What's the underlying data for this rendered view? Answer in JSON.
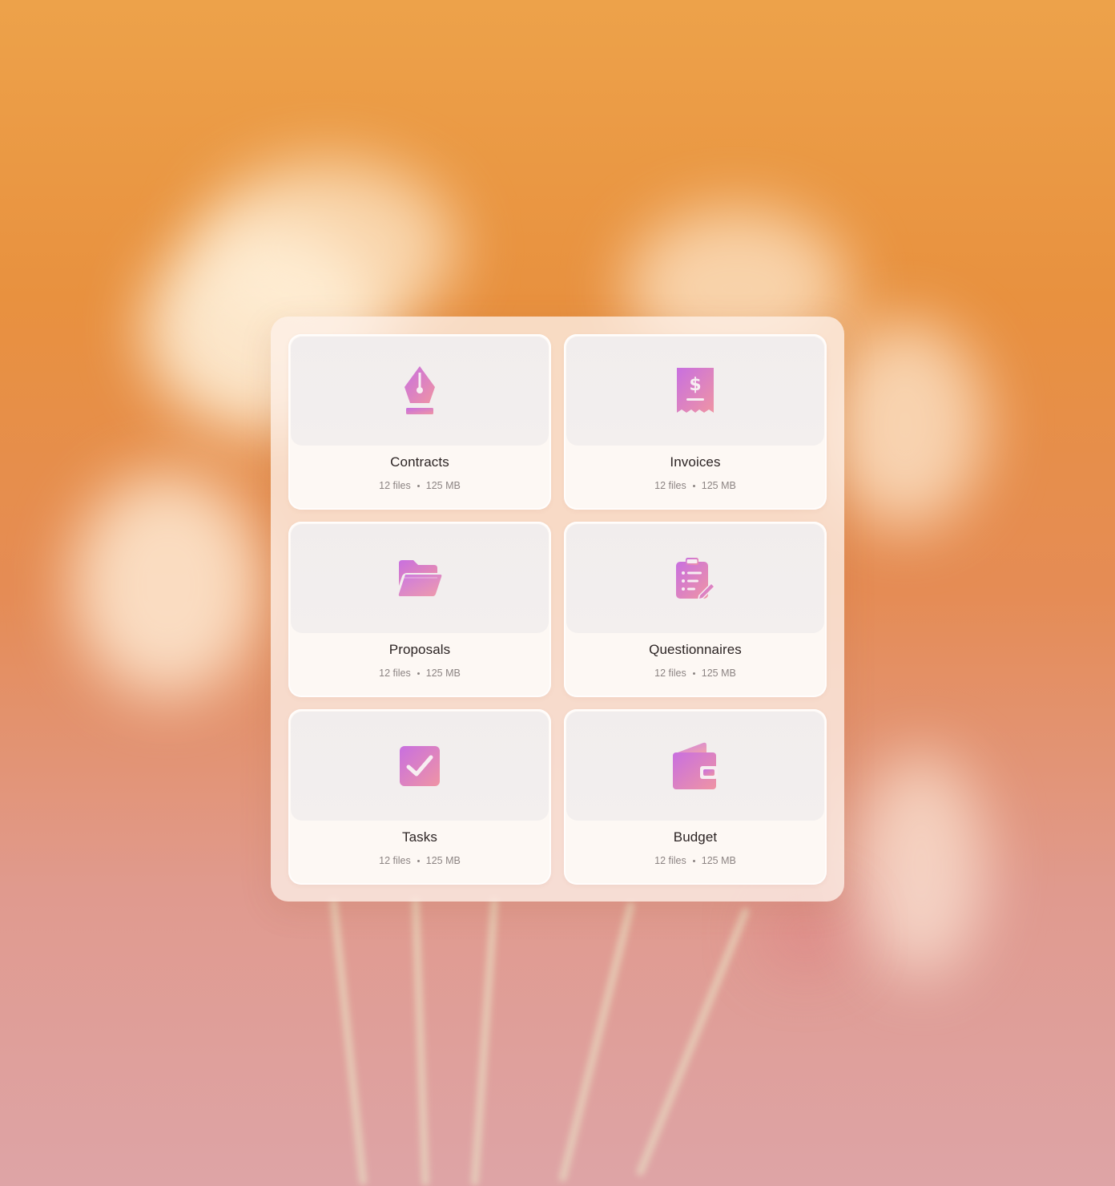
{
  "colors": {
    "icon_gradient_start": "#c86fe0",
    "icon_gradient_end": "#eb8eaa",
    "title": "#2c2424",
    "meta": "#8c8483"
  },
  "folders": [
    {
      "title": "Contracts",
      "files": "12 files",
      "size": "125 MB",
      "icon": "pen-nib-icon"
    },
    {
      "title": "Invoices",
      "files": "12 files",
      "size": "125 MB",
      "icon": "receipt-dollar-icon"
    },
    {
      "title": "Proposals",
      "files": "12 files",
      "size": "125 MB",
      "icon": "folder-open-icon"
    },
    {
      "title": "Questionnaires",
      "files": "12 files",
      "size": "125 MB",
      "icon": "clipboard-edit-icon"
    },
    {
      "title": "Tasks",
      "files": "12 files",
      "size": "125 MB",
      "icon": "checkbox-check-icon"
    },
    {
      "title": "Budget",
      "files": "12 files",
      "size": "125 MB",
      "icon": "wallet-icon"
    }
  ]
}
